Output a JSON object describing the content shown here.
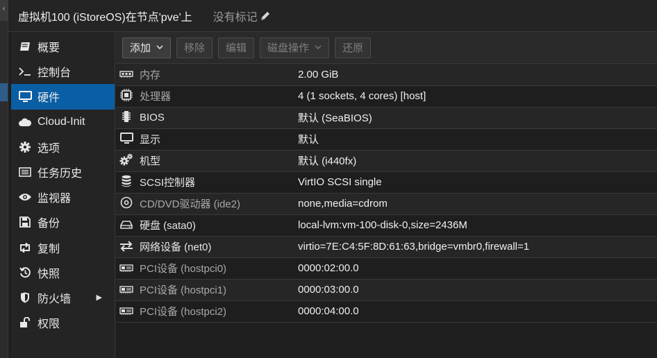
{
  "window": {
    "title": "虚拟机100 (iStoreOS)在节点'pve'上",
    "tags_label": "没有标记"
  },
  "sidebar": {
    "items": [
      {
        "label": "概要",
        "icon": "book-icon"
      },
      {
        "label": "控制台",
        "icon": "terminal-icon"
      },
      {
        "label": "硬件",
        "icon": "monitor-icon",
        "active": true
      },
      {
        "label": "Cloud-Init",
        "icon": "cloud-icon"
      },
      {
        "label": "选项",
        "icon": "gear-icon"
      },
      {
        "label": "任务历史",
        "icon": "list-icon"
      },
      {
        "label": "监视器",
        "icon": "eye-icon"
      },
      {
        "label": "备份",
        "icon": "floppy-icon"
      },
      {
        "label": "复制",
        "icon": "retweet-icon"
      },
      {
        "label": "快照",
        "icon": "history-icon"
      },
      {
        "label": "防火墙",
        "icon": "shield-icon",
        "has_submenu": true
      },
      {
        "label": "权限",
        "icon": "unlock-icon"
      }
    ]
  },
  "toolbar": {
    "add_label": "添加",
    "remove_label": "移除",
    "edit_label": "编辑",
    "disk_action_label": "磁盘操作",
    "revert_label": "还原"
  },
  "hardware": {
    "rows": [
      {
        "icon": "memory-icon",
        "name": "内存",
        "value": "2.00 GiB",
        "dim": true
      },
      {
        "icon": "cpu-icon",
        "name": "处理器",
        "value": "4 (1 sockets, 4 cores) [host]",
        "dim": true
      },
      {
        "icon": "chip-icon",
        "name": "BIOS",
        "value": "默认 (SeaBIOS)",
        "dim": false
      },
      {
        "icon": "monitor-icon",
        "name": "显示",
        "value": "默认",
        "dim": false
      },
      {
        "icon": "gears-icon",
        "name": "机型",
        "value": "默认 (i440fx)",
        "dim": false
      },
      {
        "icon": "database-icon",
        "name": "SCSI控制器",
        "value": "VirtIO SCSI single",
        "dim": false
      },
      {
        "icon": "cdrom-icon",
        "name": "CD/DVD驱动器 (ide2)",
        "value": "none,media=cdrom",
        "dim": true
      },
      {
        "icon": "harddisk-icon",
        "name": "硬盘 (sata0)",
        "value": "local-lvm:vm-100-disk-0,size=2436M",
        "dim": false
      },
      {
        "icon": "network-icon",
        "name": "网络设备 (net0)",
        "value": "virtio=7E:C4:5F:8D:61:63,bridge=vmbr0,firewall=1",
        "dim": false
      },
      {
        "icon": "pci-icon",
        "name": "PCI设备 (hostpci0)",
        "value": "0000:02:00.0",
        "dim": true
      },
      {
        "icon": "pci-icon",
        "name": "PCI设备 (hostpci1)",
        "value": "0000:03:00.0",
        "dim": true
      },
      {
        "icon": "pci-icon",
        "name": "PCI设备 (hostpci2)",
        "value": "0000:04:00.0",
        "dim": true
      }
    ]
  },
  "colors": {
    "active_nav": "#0a5ea3",
    "background": "#1f1f1f",
    "row_alt": "#262626"
  }
}
